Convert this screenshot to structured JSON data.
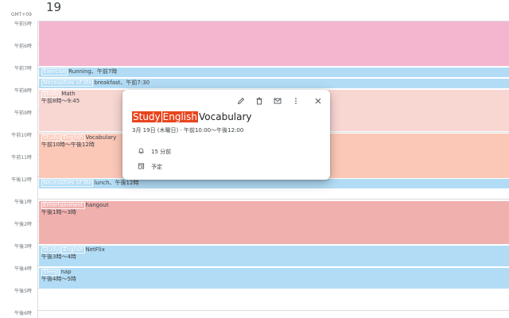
{
  "day": "19",
  "timezone": "GMT+09",
  "hours": [
    "午前5時",
    "午前6時",
    "午前7時",
    "午前8時",
    "午前9時",
    "午前10時",
    "午前11時",
    "午後12時",
    "午後1時",
    "午後2時",
    "午後3時",
    "午後4時",
    "午後5時",
    "午後6時"
  ],
  "colors": {
    "pink": "#f4b6cf",
    "blue": "#b2dcf5",
    "peach_light": "#f8d7d3",
    "peach": "#fbc8b8",
    "red": "#f0b0ae",
    "tomato": "#e8451e"
  },
  "events": [
    {
      "tags": [],
      "title": "",
      "sub": ""
    },
    {
      "tags": [
        "Exercise"
      ],
      "title": "Running、午前7時",
      "sub": ""
    },
    {
      "tags": [
        "Necessities of life"
      ],
      "title": "breakfast、午前7:30",
      "sub": ""
    },
    {
      "tags": [
        "Study"
      ],
      "title": "Math",
      "sub": "午前8時～9:45"
    },
    {
      "tags": [
        "Study",
        "English"
      ],
      "title": "Vocabulary",
      "sub": "午前10時～午後12時"
    },
    {
      "tags": [
        "Necessities of life"
      ],
      "title": "lunch、午後12時",
      "sub": ""
    },
    {
      "tags": [
        "Entertainment"
      ],
      "title": "hangout",
      "sub": "午後1時～3時"
    },
    {
      "tags": [
        "Study",
        "English"
      ],
      "title": "NetFlix",
      "sub": "午後3時～4時"
    },
    {
      "tags": [
        "Sleep"
      ],
      "title": "nap",
      "sub": "午後4時～5時"
    }
  ],
  "popup": {
    "tag1": "Study",
    "tag2": "English",
    "title": "Vocabulary",
    "when": "3月 19日 (木曜日)  ·  午前10:00～午後12:00",
    "reminder": "15 分前",
    "status": "予定",
    "icons": [
      "edit-icon",
      "delete-icon",
      "email-icon",
      "more-options-icon",
      "close-icon"
    ]
  }
}
